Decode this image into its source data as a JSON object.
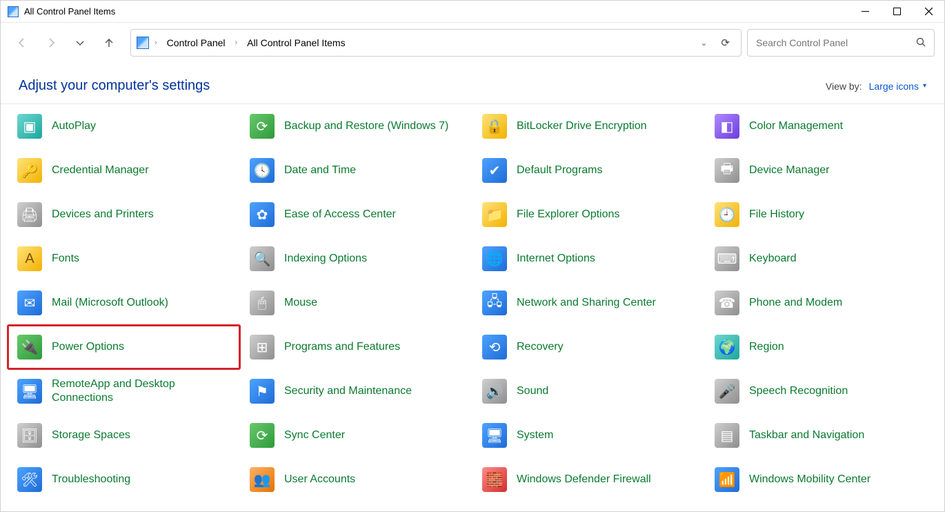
{
  "window": {
    "title": "All Control Panel Items"
  },
  "breadcrumb": {
    "root": "Control Panel",
    "current": "All Control Panel Items"
  },
  "search": {
    "placeholder": "Search Control Panel"
  },
  "header": {
    "adjust_label": "Adjust your computer's settings",
    "viewby_label": "View by:",
    "viewby_value": "Large icons"
  },
  "items": [
    {
      "label": "AutoPlay",
      "icon": "autoplay-icon",
      "glyph": "▣",
      "iclass": "ic-teal"
    },
    {
      "label": "Backup and Restore (Windows 7)",
      "icon": "backup-restore-icon",
      "glyph": "⟳",
      "iclass": "ic-green"
    },
    {
      "label": "BitLocker Drive Encryption",
      "icon": "bitlocker-icon",
      "glyph": "🔒",
      "iclass": "ic-yellow"
    },
    {
      "label": "Color Management",
      "icon": "color-management-icon",
      "glyph": "◧",
      "iclass": "ic-purple"
    },
    {
      "label": "Credential Manager",
      "icon": "credential-manager-icon",
      "glyph": "🔑",
      "iclass": "ic-yellow"
    },
    {
      "label": "Date and Time",
      "icon": "date-time-icon",
      "glyph": "🕓",
      "iclass": "ic-blue"
    },
    {
      "label": "Default Programs",
      "icon": "default-programs-icon",
      "glyph": "✔",
      "iclass": "ic-blue"
    },
    {
      "label": "Device Manager",
      "icon": "device-manager-icon",
      "glyph": "🖶",
      "iclass": "ic-gray"
    },
    {
      "label": "Devices and Printers",
      "icon": "devices-printers-icon",
      "glyph": "🖨",
      "iclass": "ic-gray"
    },
    {
      "label": "Ease of Access Center",
      "icon": "ease-of-access-icon",
      "glyph": "✿",
      "iclass": "ic-blue"
    },
    {
      "label": "File Explorer Options",
      "icon": "file-explorer-options-icon",
      "glyph": "📁",
      "iclass": "ic-yellow"
    },
    {
      "label": "File History",
      "icon": "file-history-icon",
      "glyph": "🕘",
      "iclass": "ic-yellow"
    },
    {
      "label": "Fonts",
      "icon": "fonts-icon",
      "glyph": "A",
      "iclass": "ic-yellow"
    },
    {
      "label": "Indexing Options",
      "icon": "indexing-options-icon",
      "glyph": "🔍",
      "iclass": "ic-gray"
    },
    {
      "label": "Internet Options",
      "icon": "internet-options-icon",
      "glyph": "🌐",
      "iclass": "ic-blue"
    },
    {
      "label": "Keyboard",
      "icon": "keyboard-icon",
      "glyph": "⌨",
      "iclass": "ic-gray"
    },
    {
      "label": "Mail (Microsoft Outlook)",
      "icon": "mail-icon",
      "glyph": "✉",
      "iclass": "ic-blue"
    },
    {
      "label": "Mouse",
      "icon": "mouse-icon",
      "glyph": "🖱",
      "iclass": "ic-gray"
    },
    {
      "label": "Network and Sharing Center",
      "icon": "network-sharing-icon",
      "glyph": "🖧",
      "iclass": "ic-blue"
    },
    {
      "label": "Phone and Modem",
      "icon": "phone-modem-icon",
      "glyph": "☎",
      "iclass": "ic-gray"
    },
    {
      "label": "Power Options",
      "icon": "power-options-icon",
      "glyph": "🔌",
      "iclass": "ic-green",
      "highlight": true
    },
    {
      "label": "Programs and Features",
      "icon": "programs-features-icon",
      "glyph": "⊞",
      "iclass": "ic-gray"
    },
    {
      "label": "Recovery",
      "icon": "recovery-icon",
      "glyph": "⟲",
      "iclass": "ic-blue"
    },
    {
      "label": "Region",
      "icon": "region-icon",
      "glyph": "🌍",
      "iclass": "ic-teal"
    },
    {
      "label": "RemoteApp and Desktop Connections",
      "icon": "remoteapp-icon",
      "glyph": "🖥",
      "iclass": "ic-blue"
    },
    {
      "label": "Security and Maintenance",
      "icon": "security-maintenance-icon",
      "glyph": "⚑",
      "iclass": "ic-blue"
    },
    {
      "label": "Sound",
      "icon": "sound-icon",
      "glyph": "🔊",
      "iclass": "ic-gray"
    },
    {
      "label": "Speech Recognition",
      "icon": "speech-recognition-icon",
      "glyph": "🎤",
      "iclass": "ic-gray"
    },
    {
      "label": "Storage Spaces",
      "icon": "storage-spaces-icon",
      "glyph": "🗄",
      "iclass": "ic-gray"
    },
    {
      "label": "Sync Center",
      "icon": "sync-center-icon",
      "glyph": "⟳",
      "iclass": "ic-green"
    },
    {
      "label": "System",
      "icon": "system-icon",
      "glyph": "🖥",
      "iclass": "ic-blue"
    },
    {
      "label": "Taskbar and Navigation",
      "icon": "taskbar-navigation-icon",
      "glyph": "▤",
      "iclass": "ic-gray"
    },
    {
      "label": "Troubleshooting",
      "icon": "troubleshooting-icon",
      "glyph": "🛠",
      "iclass": "ic-blue"
    },
    {
      "label": "User Accounts",
      "icon": "user-accounts-icon",
      "glyph": "👥",
      "iclass": "ic-orange"
    },
    {
      "label": "Windows Defender Firewall",
      "icon": "defender-firewall-icon",
      "glyph": "🧱",
      "iclass": "ic-red"
    },
    {
      "label": "Windows Mobility Center",
      "icon": "mobility-center-icon",
      "glyph": "📶",
      "iclass": "ic-blue"
    }
  ],
  "scroll_offset_rows": 0.4
}
